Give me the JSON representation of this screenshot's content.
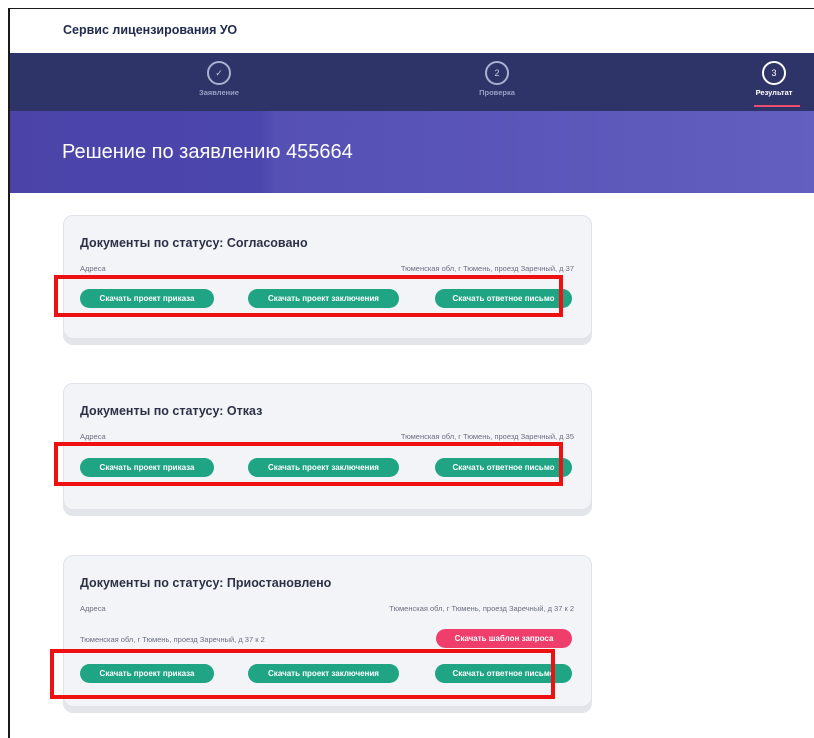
{
  "app": {
    "title": "Сервис лицензирования УО"
  },
  "stepper": {
    "steps": [
      {
        "number": "✓",
        "label": "Заявление"
      },
      {
        "number": "2",
        "label": "Проверка"
      },
      {
        "number": "3",
        "label": "Результат"
      }
    ],
    "active_step": 3
  },
  "banner": {
    "title": "Решение по заявлению 455664"
  },
  "cards": [
    {
      "title": "Документы по статусу: Согласовано",
      "address_label": "Адреса",
      "address_value": "Тюменская обл, г Тюмень, проезд Заречный, д 37",
      "buttons": [
        "Скачать проект приказа",
        "Скачать проект заключения",
        "Скачать ответное письмо"
      ]
    },
    {
      "title": "Документы по статусу: Отказ",
      "address_label": "Адреса",
      "address_value": "Тюменская обл, г Тюмень, проезд Заречный, д 35",
      "buttons": [
        "Скачать проект приказа",
        "Скачать проект заключения",
        "Скачать ответное письмо"
      ]
    },
    {
      "title": "Документы по статусу: Приостановлено",
      "address_label": "Адреса",
      "address_value": "Тюменская обл, г Тюмень, проезд Заречный, д 37 к 2",
      "request_address": "Тюменская обл, г Тюмень, проезд Заречный, д 37 к 2",
      "request_button": "Скачать шаблон запроса",
      "buttons": [
        "Скачать проект приказа",
        "Скачать проект заключения",
        "Скачать ответное письмо"
      ]
    }
  ],
  "colors": {
    "stepper_bg": "#2e3368",
    "banner_bg": "#4b43a8",
    "button_green": "#1fa584",
    "button_pink": "#ef3e6b",
    "highlight_red": "#ee1111"
  }
}
